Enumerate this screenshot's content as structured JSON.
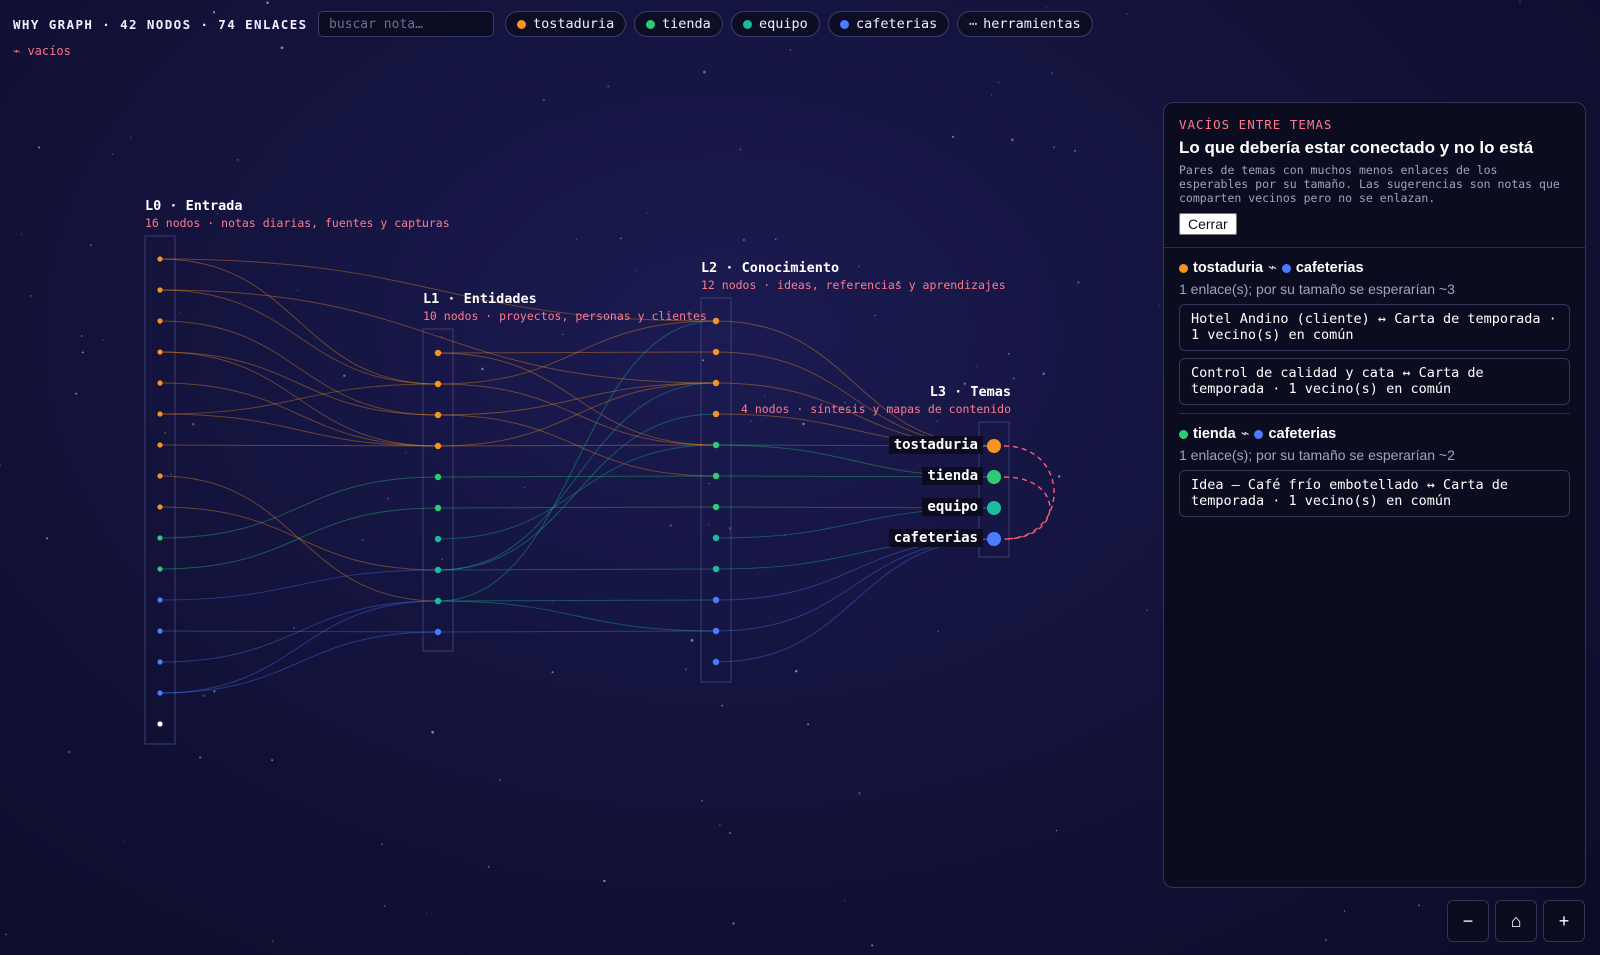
{
  "header": {
    "title": "WHY GRAPH · 42 NODOS · 74 ENLACES",
    "search_placeholder": "buscar nota…",
    "chips": [
      {
        "label": "tostaduria",
        "color": "#f7931e"
      },
      {
        "label": "tienda",
        "color": "#2ecc71"
      },
      {
        "label": "equipo",
        "color": "#1abc9c"
      },
      {
        "label": "cafeterias",
        "color": "#4a7cff"
      },
      {
        "label": "herramientas",
        "glyph": "⋯"
      }
    ],
    "gaps_link": "⌁ vacíos"
  },
  "layers": [
    {
      "title": "L0 · Entrada",
      "subtitle": "16 nodos · notas diarias, fuentes y capturas"
    },
    {
      "title": "L1 · Entidades",
      "subtitle": "10 nodos · proyectos, personas y clientes"
    },
    {
      "title": "L2 · Conocimiento",
      "subtitle": "12 nodos · ideas, referencias y aprendizajes"
    },
    {
      "title": "L3 · Temas",
      "subtitle": "4 nodos · síntesis y mapas de contenido"
    }
  ],
  "themes": [
    {
      "label": "tostaduria",
      "color": "#f7931e"
    },
    {
      "label": "tienda",
      "color": "#2ecc71"
    },
    {
      "label": "equipo",
      "color": "#1abc9c"
    },
    {
      "label": "cafeterias",
      "color": "#4a7cff"
    }
  ],
  "graph": {
    "colors": {
      "tostaduria": "#f7931e",
      "tienda": "#2ecc71",
      "equipo": "#1abc9c",
      "cafeterias": "#4a7cff",
      "sin_tema": "#ffffff",
      "gap": "#ff5a78"
    },
    "nodes": [
      [
        "tostaduria",
        "tostaduria",
        "tostaduria",
        "tostaduria",
        "tostaduria",
        "tostaduria",
        "tostaduria",
        "tostaduria",
        "tostaduria",
        "tienda",
        "tienda",
        "cafeterias",
        "cafeterias",
        "cafeterias",
        "cafeterias",
        "sin_tema"
      ],
      [
        "tostaduria",
        "tostaduria",
        "tostaduria",
        "tostaduria",
        "tienda",
        "tienda",
        "equipo",
        "equipo",
        "equipo",
        "cafeterias"
      ],
      [
        "tostaduria",
        "tostaduria",
        "tostaduria",
        "tostaduria",
        "tienda",
        "tienda",
        "tienda",
        "equipo",
        "equipo",
        "cafeterias",
        "cafeterias",
        "cafeterias"
      ],
      [
        "tostaduria",
        "tienda",
        "equipo",
        "cafeterias"
      ]
    ],
    "links": [
      [
        0,
        0,
        1,
        1
      ],
      [
        0,
        0,
        2,
        0
      ],
      [
        0,
        1,
        1,
        1
      ],
      [
        0,
        1,
        2,
        2
      ],
      [
        0,
        2,
        1,
        2
      ],
      [
        0,
        3,
        1,
        2
      ],
      [
        0,
        3,
        1,
        3
      ],
      [
        0,
        4,
        1,
        3
      ],
      [
        0,
        5,
        1,
        1
      ],
      [
        0,
        5,
        1,
        3
      ],
      [
        0,
        6,
        1,
        3
      ],
      [
        0,
        7,
        1,
        8
      ],
      [
        0,
        8,
        1,
        7
      ],
      [
        0,
        9,
        1,
        4
      ],
      [
        0,
        10,
        1,
        5
      ],
      [
        0,
        11,
        1,
        7
      ],
      [
        0,
        12,
        1,
        9
      ],
      [
        0,
        13,
        1,
        8
      ],
      [
        0,
        14,
        1,
        8
      ],
      [
        0,
        14,
        1,
        9
      ],
      [
        1,
        0,
        2,
        1
      ],
      [
        1,
        0,
        2,
        4
      ],
      [
        1,
        1,
        2,
        0
      ],
      [
        1,
        1,
        2,
        4
      ],
      [
        1,
        2,
        2,
        2
      ],
      [
        1,
        2,
        2,
        5
      ],
      [
        1,
        3,
        2,
        2
      ],
      [
        1,
        3,
        2,
        4
      ],
      [
        1,
        4,
        2,
        5
      ],
      [
        1,
        5,
        2,
        6
      ],
      [
        1,
        6,
        2,
        4
      ],
      [
        1,
        7,
        2,
        8
      ],
      [
        1,
        8,
        2,
        9
      ],
      [
        1,
        8,
        2,
        10
      ],
      [
        1,
        9,
        2,
        10
      ],
      [
        1,
        7,
        2,
        3
      ],
      [
        1,
        8,
        2,
        0
      ],
      [
        1,
        7,
        2,
        2
      ],
      [
        2,
        0,
        3,
        0
      ],
      [
        2,
        1,
        3,
        0
      ],
      [
        2,
        2,
        3,
        0
      ],
      [
        2,
        3,
        3,
        0
      ],
      [
        2,
        4,
        3,
        1
      ],
      [
        2,
        5,
        3,
        1
      ],
      [
        2,
        6,
        3,
        2
      ],
      [
        2,
        7,
        3,
        2
      ],
      [
        2,
        8,
        3,
        3
      ],
      [
        2,
        9,
        3,
        3
      ],
      [
        2,
        10,
        3,
        3
      ],
      [
        2,
        11,
        3,
        3
      ],
      [
        2,
        4,
        3,
        0
      ]
    ],
    "gaps": [
      [
        0,
        3
      ],
      [
        1,
        3
      ]
    ]
  },
  "panel": {
    "eyebrow": "VACÍOS ENTRE TEMAS",
    "title": "Lo que debería estar conectado y no lo está",
    "description": "Pares de temas con muchos menos enlaces de los esperables por su tamaño. Las sugerencias son notas que comparten vecinos pero no se enlazan.",
    "close_label": "Cerrar",
    "groups": [
      {
        "a": "tostaduria",
        "a_color": "#f7931e",
        "b": "cafeterias",
        "b_color": "#4a7cff",
        "separator": "⌁",
        "note": "1 enlace(s); por su tamaño se esperarían ~3",
        "suggestions": [
          "Hotel Andino (cliente) ↔ Carta de temporada · 1 vecino(s) en común",
          "Control de calidad y cata ↔ Carta de temporada · 1 vecino(s) en común"
        ]
      },
      {
        "a": "tienda",
        "a_color": "#2ecc71",
        "b": "cafeterias",
        "b_color": "#4a7cff",
        "separator": "⌁",
        "note": "1 enlace(s); por su tamaño se esperarían ~2",
        "suggestions": [
          "Idea — Café frío embotellado ↔ Carta de temporada · 1 vecino(s) en común"
        ]
      }
    ]
  },
  "zoom": {
    "out": "−",
    "home": "⌂",
    "in": "+"
  }
}
